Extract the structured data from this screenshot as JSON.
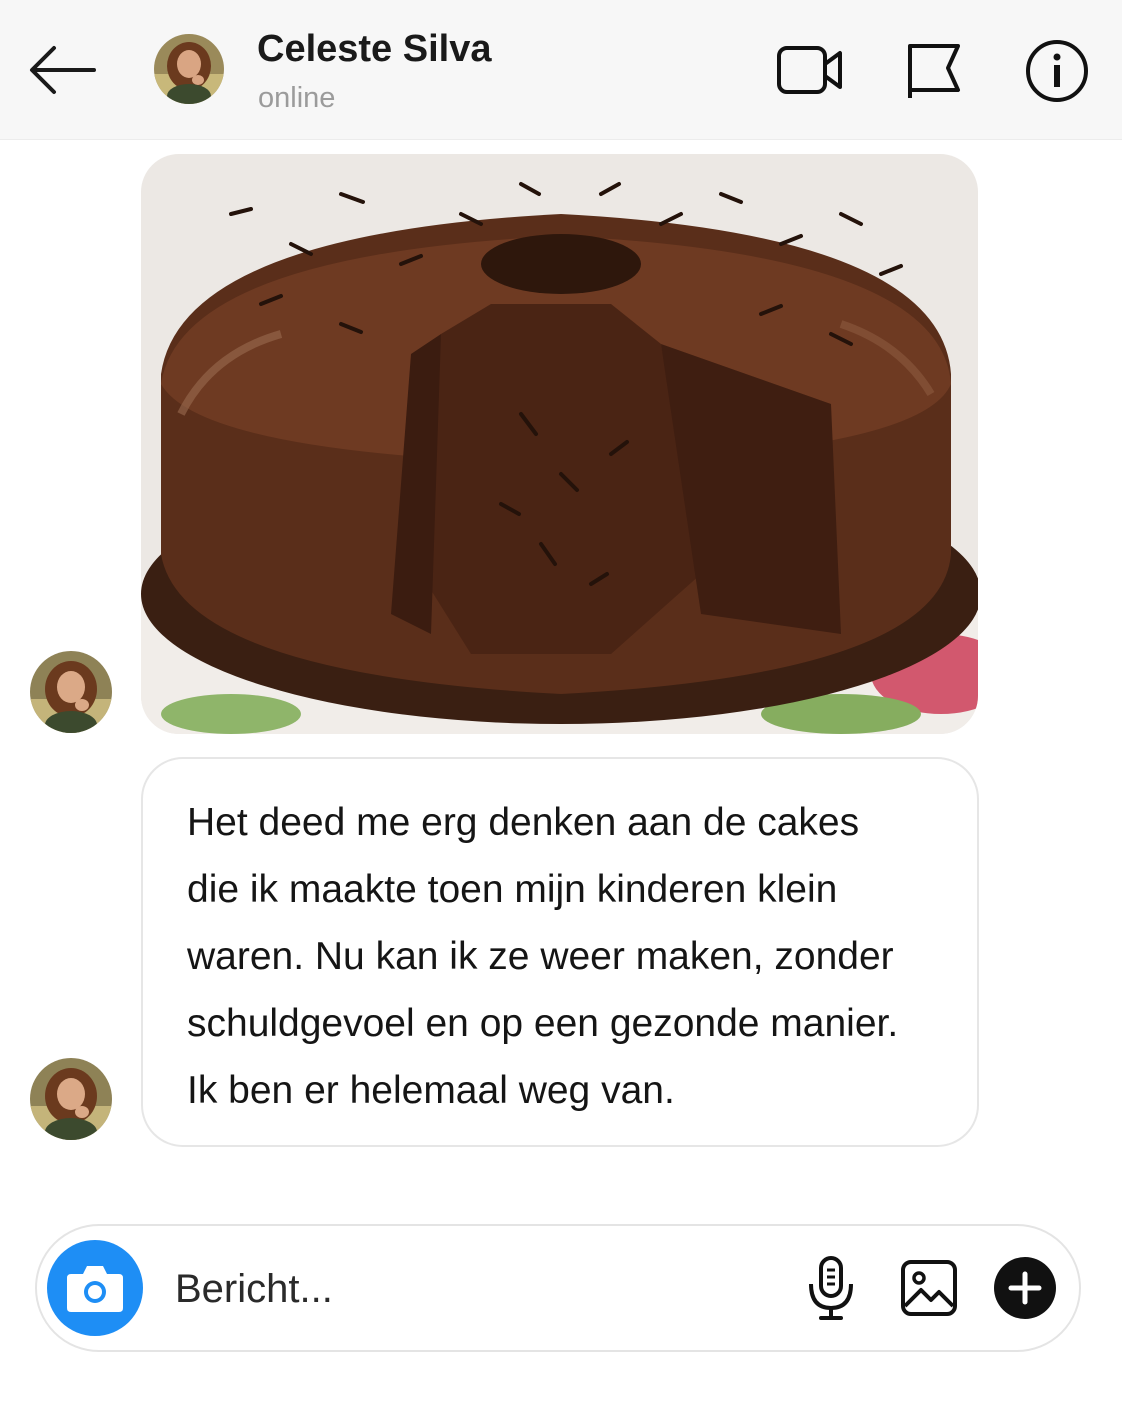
{
  "header": {
    "contact_name": "Celeste Silva",
    "status": "online",
    "icons": [
      "back-arrow-icon",
      "video-call-icon",
      "flag-icon",
      "info-icon"
    ]
  },
  "messages": [
    {
      "type": "image",
      "description_icon": "chocolate-cake-photo"
    },
    {
      "type": "text",
      "lines": [
        "Het deed me erg denken aan de cakes",
        "die ik maakte toen mijn kinderen klein",
        "waren. Nu kan ik ze weer maken, zonder",
        "schuldgevoel en op een gezonde manier.",
        "Ik ben er helemaal weg van."
      ]
    }
  ],
  "composer": {
    "placeholder": "Bericht...",
    "icons": [
      "camera-icon",
      "microphone-icon",
      "gallery-icon",
      "plus-icon"
    ]
  },
  "colors": {
    "accent": "#1e8ef5",
    "header_bg": "#f7f7f7",
    "status_text": "#9b9b9b"
  }
}
